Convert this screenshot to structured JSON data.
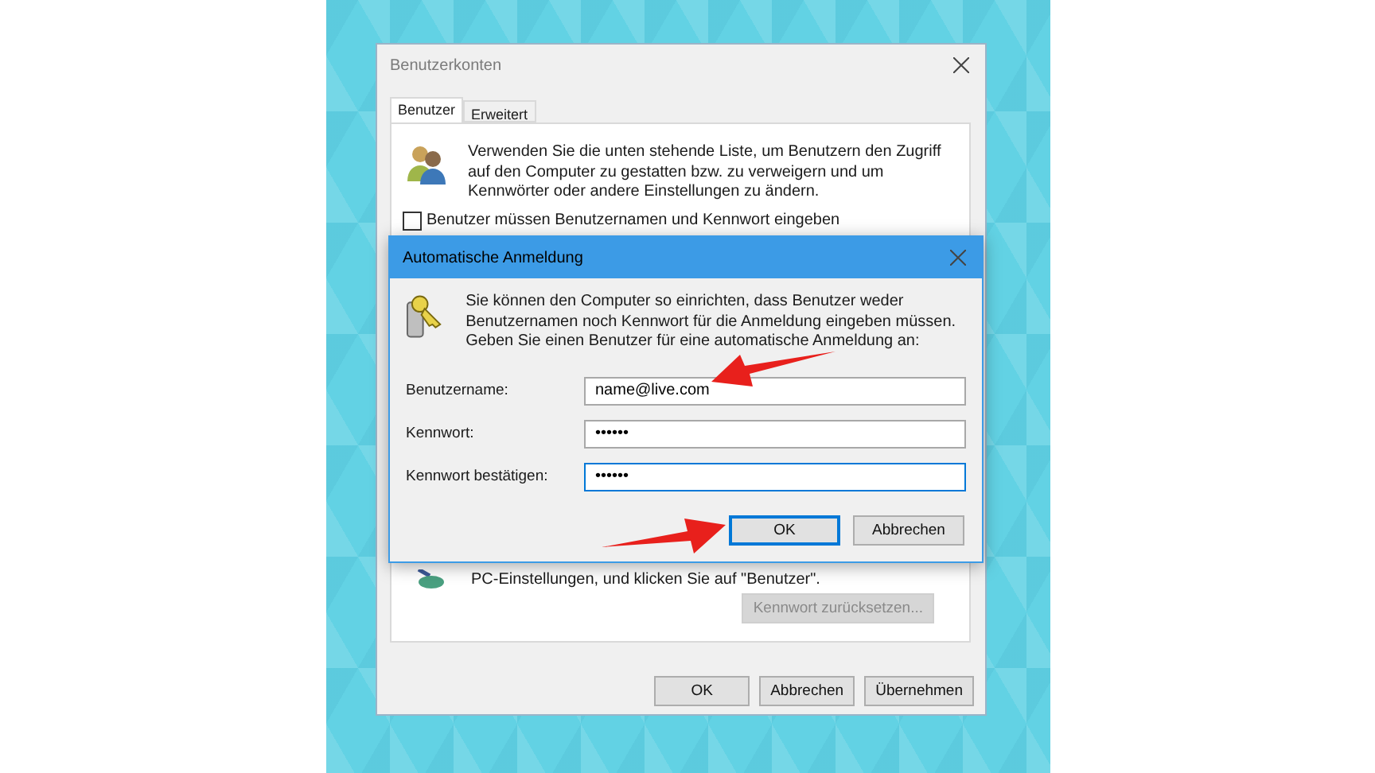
{
  "back_window": {
    "title": "Benutzerkonten",
    "tabs": [
      {
        "label": "Benutzer",
        "selected": true
      },
      {
        "label": "Erweitert",
        "selected": false
      }
    ],
    "description": "Verwenden Sie die unten stehende Liste, um Benutzern den Zugriff auf den Computer zu gestatten bzw. zu verweigern und um Kennwörter oder andere Einstellungen zu ändern.",
    "checkbox": {
      "label": "Benutzer müssen Benutzernamen und Kennwort eingeben",
      "checked": false
    },
    "note": "PC-Einstellungen, und klicken Sie auf \"Benutzer\".",
    "reset_button": {
      "label": "Kennwort zurücksetzen...",
      "disabled": true
    },
    "buttons": [
      {
        "label": "OK"
      },
      {
        "label": "Abbrechen"
      },
      {
        "label": "Übernehmen"
      }
    ]
  },
  "dialog": {
    "title": "Automatische Anmeldung",
    "description": "Sie können den Computer so einrichten, dass Benutzer weder Benutzernamen noch Kennwort für die Anmeldung eingeben müssen. Geben Sie einen Benutzer für eine automatische Anmeldung an:",
    "fields": [
      {
        "label": "Benutzername:",
        "value": "name@live.com",
        "focused": false
      },
      {
        "label": "Kennwort:",
        "value": "••••••",
        "focused": false
      },
      {
        "label": "Kennwort bestätigen:",
        "value": "••••••",
        "focused": true
      }
    ],
    "buttons": [
      {
        "label": "OK",
        "default": true
      },
      {
        "label": "Abbrechen",
        "default": false
      }
    ]
  }
}
